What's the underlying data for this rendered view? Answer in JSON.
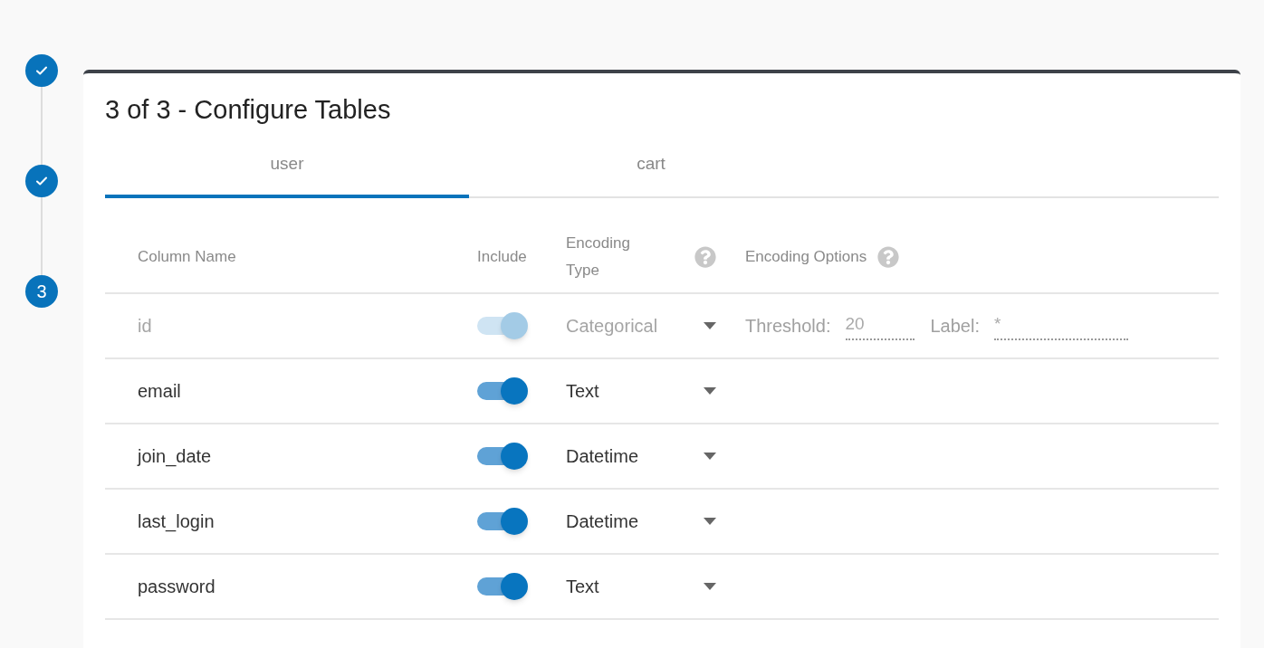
{
  "steps": [
    {
      "done": true
    },
    {
      "done": true
    },
    {
      "done": false,
      "number": "3"
    }
  ],
  "card": {
    "title": "3 of 3 - Configure Tables"
  },
  "tabs": [
    {
      "label": "user",
      "selected": true
    },
    {
      "label": "cart",
      "selected": false
    }
  ],
  "table": {
    "columns": [
      {
        "label": "Column Name",
        "help": false
      },
      {
        "label": "Include",
        "help": false
      },
      {
        "label": "Encoding Type",
        "help": true
      },
      {
        "label": "Encoding Options",
        "help": true
      }
    ],
    "rows": [
      {
        "name": "id",
        "included": true,
        "disabled": true,
        "encoding": "Categorical",
        "options": [
          {
            "label": "Threshold:",
            "value": "20"
          },
          {
            "label": "Label:",
            "value": "*"
          }
        ]
      },
      {
        "name": "email",
        "included": true,
        "disabled": false,
        "encoding": "Text"
      },
      {
        "name": "join_date",
        "included": true,
        "disabled": false,
        "encoding": "Datetime"
      },
      {
        "name": "last_login",
        "included": true,
        "disabled": false,
        "encoding": "Datetime"
      },
      {
        "name": "password",
        "included": true,
        "disabled": false,
        "encoding": "Text"
      }
    ]
  }
}
